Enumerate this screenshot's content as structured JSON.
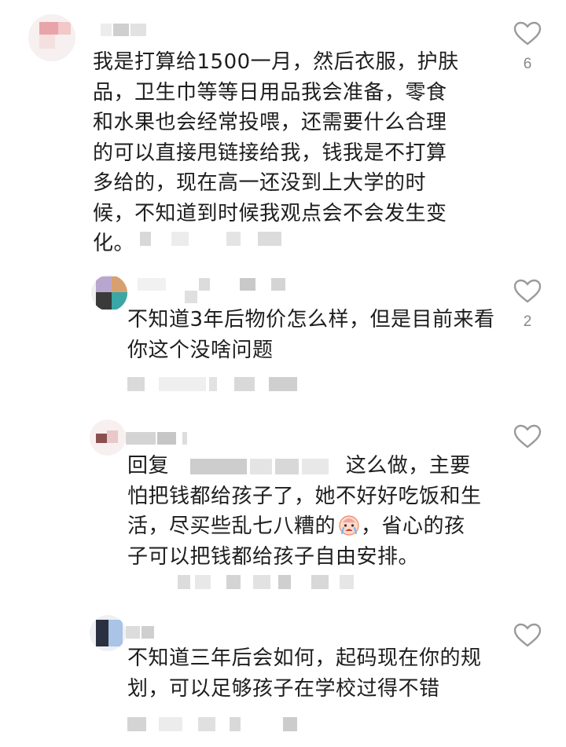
{
  "comments": [
    {
      "text": "我是打算给1500一月，然后衣服，护肤品，卫生巾等等日用品我会准备，零食和水果也会经常投喂，还需要什么合理的可以直接甩链接给我，钱我是不打算多给的，现在高一还没到上大学的时候，不知道到时候我观点会不会发生变化。",
      "likes": "6"
    },
    {
      "text": "不知道3年后物价怎么样，但是目前来看你这个没啥问题",
      "likes": "2"
    },
    {
      "prefix": "回复",
      "text_after_mention": "这么做，主要怕把钱都给孩子了，她不好好吃饭和生活，尽买些乱七八糟的",
      "emoji": "crying-face",
      "text_end": "，省心的孩子可以把钱都给孩子自由安排。",
      "likes": ""
    },
    {
      "text": "不知道三年后会如何，起码现在你的规划，可以足够孩子在学校过得不错",
      "likes": ""
    }
  ],
  "colors": {
    "text": "#1e1e1e",
    "icon": "#9a9a9a",
    "count": "#888888",
    "blur": "#d4d4d4"
  }
}
